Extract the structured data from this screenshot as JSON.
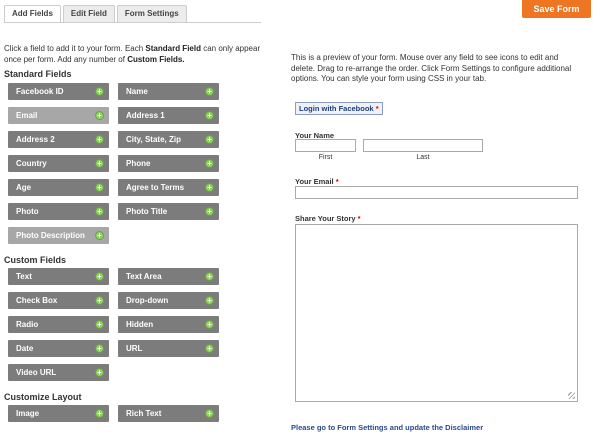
{
  "tabs": [
    {
      "label": "Add Fields",
      "active": true
    },
    {
      "label": "Edit Field",
      "active": false
    },
    {
      "label": "Form Settings",
      "active": false
    }
  ],
  "save_button": "Save Form",
  "intro": {
    "part1": "Click a field to add it to your form. Each ",
    "bold1": "Standard Field",
    "part2": " can only appear once per form. Add any number of ",
    "bold2": "Custom Fields."
  },
  "sections": {
    "standard": "Standard Fields",
    "custom": "Custom Fields",
    "layout": "Customize Layout"
  },
  "standard_fields": [
    "Facebook ID",
    "Name",
    "Email",
    "Address 1",
    "Address 2",
    "City, State, Zip",
    "Country",
    "Phone",
    "Age",
    "Agree to Terms",
    "Photo",
    "Photo Title",
    "Photo Description"
  ],
  "custom_fields": [
    "Text",
    "Text Area",
    "Check Box",
    "Drop-down",
    "Radio",
    "Hidden",
    "Date",
    "URL",
    "Video URL"
  ],
  "layout_fields": [
    "Image",
    "Rich Text"
  ],
  "field_plus_icon": "+",
  "preview": {
    "description": "This is a preview of your form. Mouse over any field to see icons to edit and delete. Drag to re-arrange the order. Click Form Settings to configure additional options. You can style your form using CSS in your tab.",
    "facebook_login": "Login with Facebook",
    "required_marker": "*",
    "name_label": "Your Name",
    "first_label": "First",
    "last_label": "Last",
    "email_label": "Your Email",
    "story_label": "Share Your Story",
    "disclaimer": "Please go to Form Settings and update the Disclaimer"
  },
  "colors": {
    "accent": "#ee7522",
    "field_bg": "#7c7c7c",
    "field_used_bg": "#a7a7a7",
    "plus_icon": "#8fcf62",
    "link": "#2a4a8c"
  }
}
